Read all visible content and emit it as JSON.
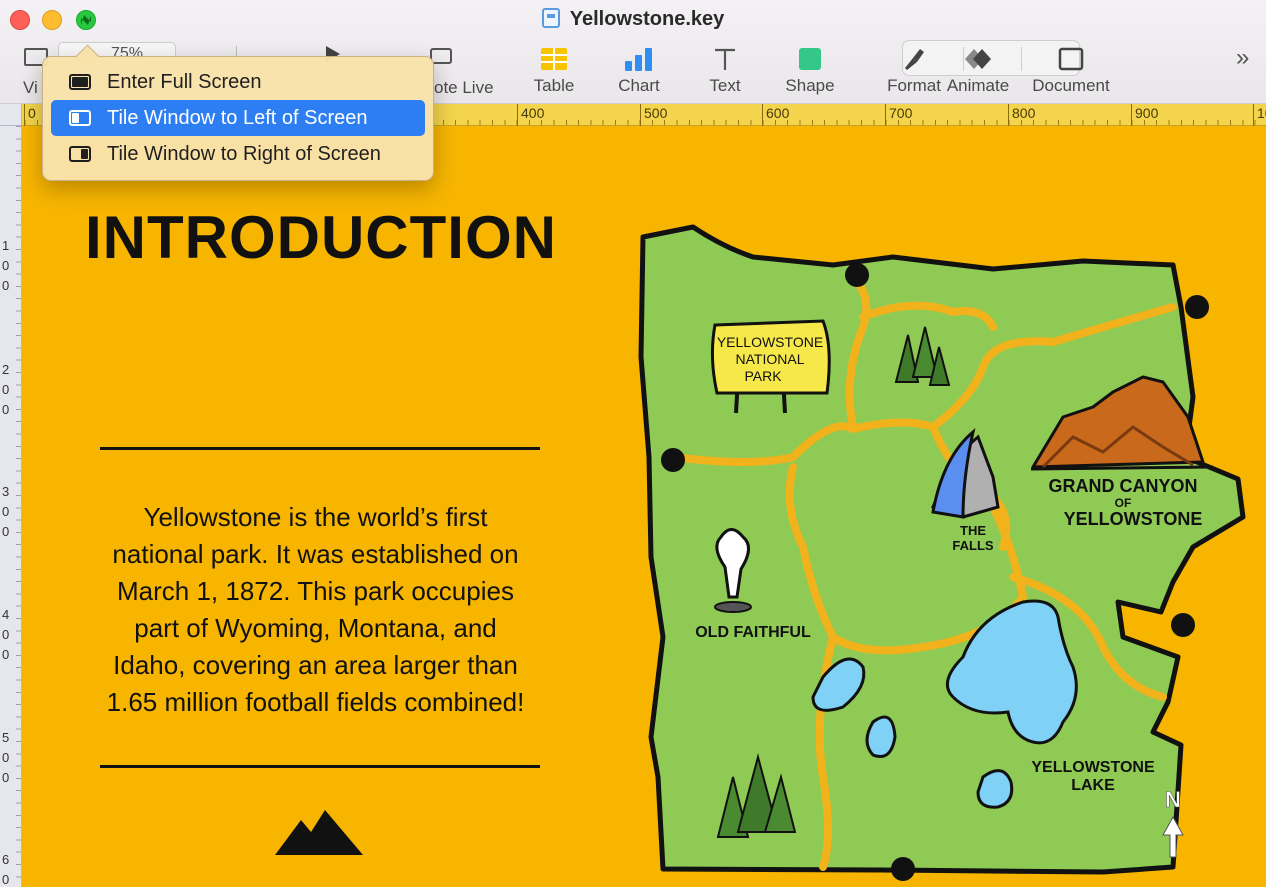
{
  "window": {
    "title": "Yellowstone.key"
  },
  "toolbar": {
    "view_label_partial": "Vi",
    "zoom_partial": "75%",
    "keynote_live_partial": "ote Live",
    "items": [
      {
        "label": "Table",
        "icon": "table-icon"
      },
      {
        "label": "Chart",
        "icon": "chart-icon"
      },
      {
        "label": "Text",
        "icon": "text-icon"
      },
      {
        "label": "Shape",
        "icon": "shape-icon"
      },
      {
        "label": "Format",
        "icon": "format-brush-icon"
      },
      {
        "label": "Animate",
        "icon": "animate-icon"
      },
      {
        "label": "Document",
        "icon": "document-icon"
      }
    ],
    "more": "»"
  },
  "menu": {
    "items": [
      {
        "label": "Enter Full Screen",
        "selected": false
      },
      {
        "label": "Tile Window to Left of Screen",
        "selected": true
      },
      {
        "label": "Tile Window to Right of Screen",
        "selected": false
      }
    ]
  },
  "ruler": {
    "top": [
      "0",
      "400",
      "500",
      "600",
      "700",
      "800",
      "900",
      "10"
    ],
    "left": [
      "1\n0\n0",
      "2\n0\n0",
      "3\n0\n0",
      "4\n0\n0",
      "5\n0\n0",
      "6\n0"
    ]
  },
  "slide": {
    "heading": "INTRODUCTION",
    "body_lines": [
      "Yellowstone is the world’s first",
      "national park. It was established on",
      "March 1, 1872. This park occupies",
      "part of Wyoming, Montana, and",
      "Idaho, covering an area larger than",
      "1.65 million football fields combined!"
    ],
    "map_labels": {
      "sign": [
        "YELLOWSTONE",
        "NATIONAL",
        "PARK"
      ],
      "canyon": [
        "GRAND CANYON",
        "OF",
        "YELLOWSTONE"
      ],
      "falls": [
        "THE",
        "FALLS"
      ],
      "geyser": "OLD FAITHFUL",
      "lake": [
        "YELLOWSTONE",
        "LAKE"
      ],
      "north": "N"
    }
  },
  "colors": {
    "slide_bg": "#f7b500",
    "map_green": "#8fca55",
    "path": "#f2b21b",
    "water": "#7fd2f5",
    "canyon": "#c8691c",
    "menu_selected": "#2d7ef2"
  }
}
